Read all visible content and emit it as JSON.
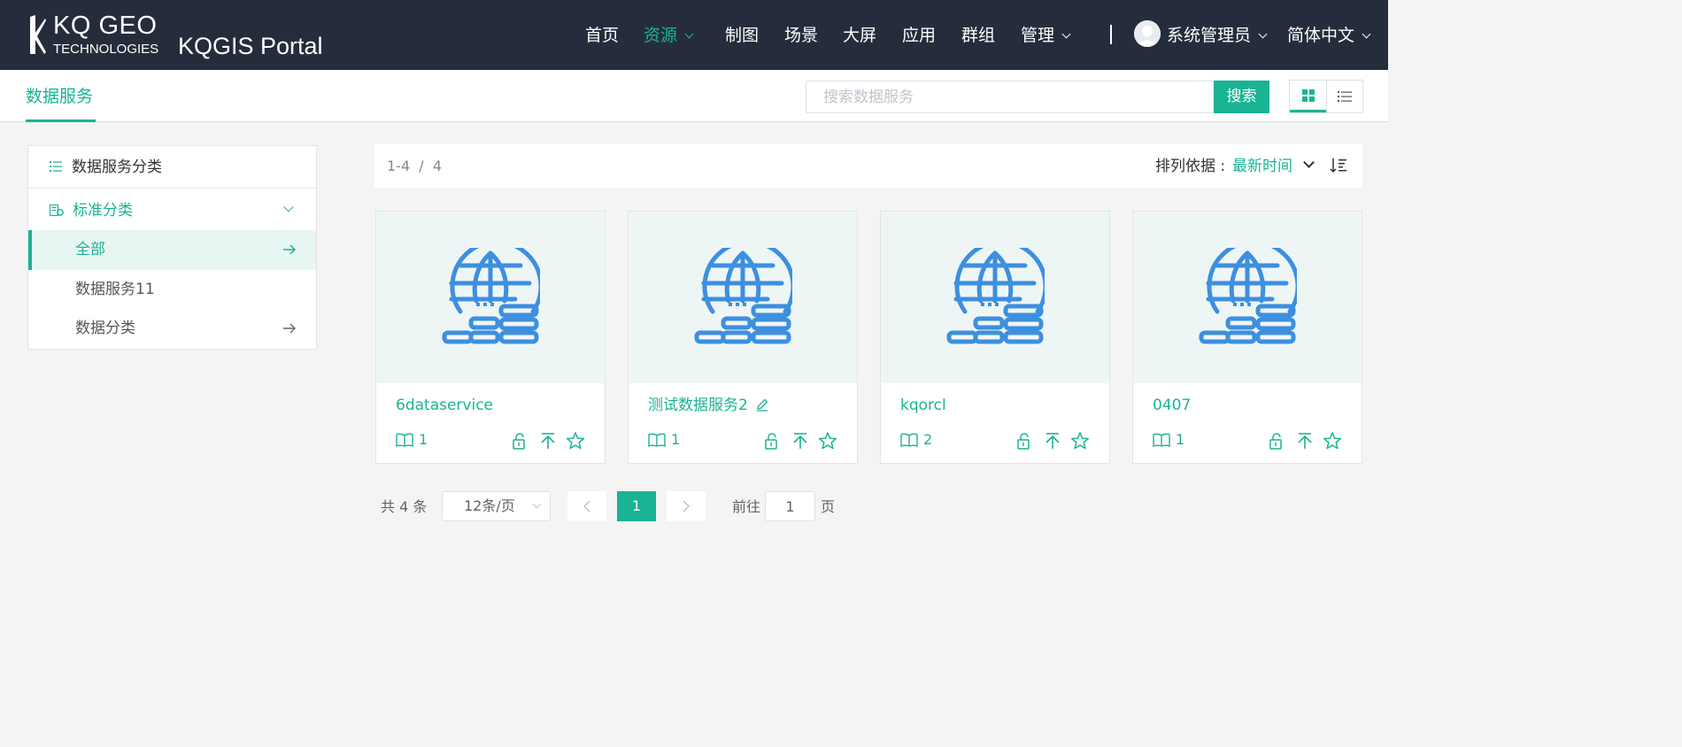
{
  "brand": {
    "company_line1": "KQ GEO",
    "company_line2": "TECHNOLOGIES",
    "portal_title": "KQGIS Portal",
    "accent_color": "#1ab394",
    "header_color": "#252d3c"
  },
  "nav": {
    "items": [
      {
        "label": "首页"
      },
      {
        "label": "资源"
      },
      {
        "label": "制图"
      },
      {
        "label": "场景"
      },
      {
        "label": "大屏"
      },
      {
        "label": "应用"
      },
      {
        "label": "群组"
      },
      {
        "label": "管理"
      }
    ],
    "active": "资源",
    "user_name": "系统管理员",
    "language": "简体中文"
  },
  "subheader": {
    "title": "数据服务",
    "search_placeholder": "搜索数据服务",
    "search_button": "搜索",
    "view_mode": "grid"
  },
  "sidebar": {
    "header": "数据服务分类",
    "group_label": "标准分类",
    "items": [
      {
        "label": "全部",
        "active": true,
        "has_arrow": true
      },
      {
        "label": "数据服务11",
        "active": false,
        "has_arrow": false
      },
      {
        "label": "数据分类",
        "active": false,
        "has_arrow": true
      }
    ]
  },
  "toolbar": {
    "range": "1-4  /  4",
    "sort_label": "排列依据 :",
    "sort_value": "最新时间"
  },
  "cards": [
    {
      "title": "6dataservice",
      "count": "1",
      "editable": false
    },
    {
      "title": "测试数据服务2",
      "count": "1",
      "editable": true
    },
    {
      "title": "kqorcl",
      "count": "2",
      "editable": false
    },
    {
      "title": "0407",
      "count": "1",
      "editable": false
    }
  ],
  "pagination": {
    "total": "共 4 条",
    "page_size": "12条/页",
    "current_page": "1",
    "goto_label": "前往",
    "goto_value": "1",
    "goto_suffix": "页"
  }
}
